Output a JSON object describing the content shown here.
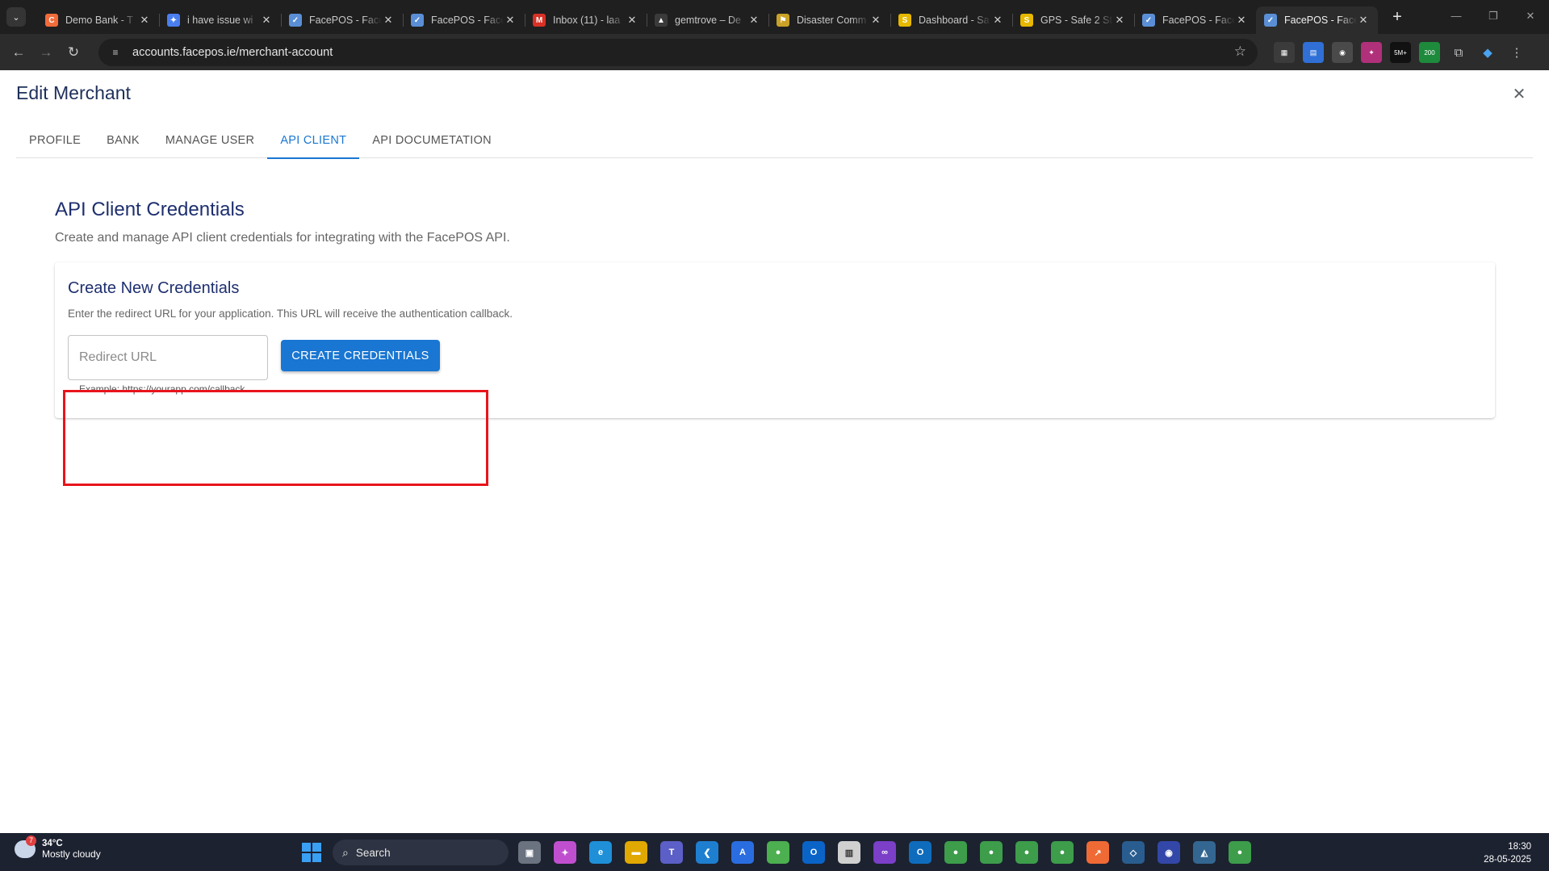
{
  "browser": {
    "tabs": [
      {
        "title": "Demo Bank - T",
        "color": "#f26b3a",
        "glyph": "C"
      },
      {
        "title": "i have issue wi",
        "color": "#4a7ff0",
        "glyph": "✦"
      },
      {
        "title": "FacePOS - Face",
        "color": "#5a8fd6",
        "glyph": "✓"
      },
      {
        "title": "FacePOS - Face",
        "color": "#5a8fd6",
        "glyph": "✓"
      },
      {
        "title": "Inbox (11) - laa",
        "color": "#d93025",
        "glyph": "M"
      },
      {
        "title": "gemtrove – De",
        "color": "#3a3a3a",
        "glyph": "▲"
      },
      {
        "title": "Disaster Comm",
        "color": "#c9a227",
        "glyph": "⚑"
      },
      {
        "title": "Dashboard - Sa",
        "color": "#e6b800",
        "glyph": "S"
      },
      {
        "title": "GPS - Safe 2 St",
        "color": "#e6b800",
        "glyph": "S"
      },
      {
        "title": "FacePOS - Face",
        "color": "#5a8fd6",
        "glyph": "✓"
      },
      {
        "title": "FacePOS - Face",
        "color": "#5a8fd6",
        "glyph": "✓"
      }
    ],
    "url": "accounts.facepos.ie/merchant-account"
  },
  "dialog": {
    "title": "Edit Merchant",
    "tabs": [
      "PROFILE",
      "BANK",
      "MANAGE USER",
      "API CLIENT",
      "API DOCUMETATION"
    ],
    "active_tab": "API CLIENT"
  },
  "section": {
    "title": "API Client Credentials",
    "subtitle": "Create and manage API client credentials for integrating with the FacePOS API."
  },
  "card": {
    "title": "Create New Credentials",
    "description": "Enter the redirect URL for your application. This URL will receive the authentication callback.",
    "input_placeholder": "Redirect URL",
    "input_value": "",
    "helper": "Example: https://yourapp.com/callback",
    "button_label": "CREATE CREDENTIALS"
  },
  "taskbar": {
    "weather_badge": "7",
    "temperature": "34°C",
    "weather_desc": "Mostly cloudy",
    "search_label": "Search",
    "time": "18:30",
    "date": "28-05-2025"
  },
  "extensions": {
    "badge_1": "5M+",
    "badge_2": "200"
  },
  "colors": {
    "accent": "#1976d2",
    "highlight": "#e8141c",
    "heading": "#1e2f6e"
  }
}
